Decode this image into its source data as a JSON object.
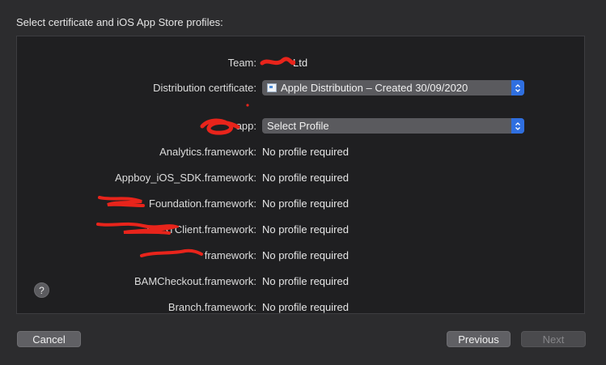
{
  "header": {
    "title": "Select certificate and iOS App Store profiles:"
  },
  "team": {
    "label": "Team:",
    "value": "Ltd"
  },
  "certificate": {
    "label": "Distribution certificate:",
    "value": "Apple Distribution – Created 30/09/2020"
  },
  "app": {
    "label": "app:",
    "value": "Select Profile"
  },
  "frameworks": [
    {
      "label": "Analytics.framework:",
      "value": "No profile required"
    },
    {
      "label": "Appboy_iOS_SDK.framework:",
      "value": "No profile required"
    },
    {
      "label": "Foundation.framework:",
      "value": "No profile required"
    },
    {
      "label": "RESTClient.framework:",
      "value": "No profile required"
    },
    {
      "label": "framework:",
      "value": "No profile required"
    },
    {
      "label": "BAMCheckout.framework:",
      "value": "No profile required"
    },
    {
      "label": "Branch.framework:",
      "value": "No profile required"
    }
  ],
  "buttons": {
    "help": "?",
    "cancel": "Cancel",
    "previous": "Previous",
    "next": "Next"
  },
  "colors": {
    "accent": "#2f6fe0",
    "redaction": "#e8241b"
  },
  "icons": {
    "certificate": "certificate-icon",
    "stepper": "up-down-chevron-icon",
    "help": "question-mark-icon"
  }
}
